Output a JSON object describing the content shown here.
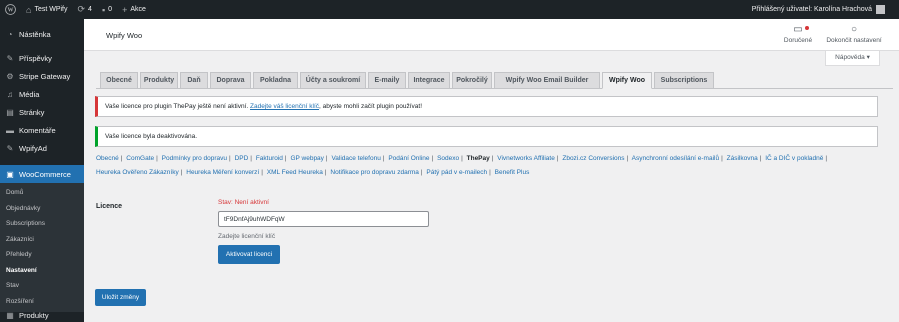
{
  "adminbar": {
    "site_name": "Test WPify",
    "updates_count": "4",
    "comments_count": "0",
    "new_label": "Akce",
    "user_greeting": "Přihlášený uživatel: Karolína Hrachová"
  },
  "sidebar": {
    "items": [
      {
        "label": "Nástěnka",
        "icon": "dashboard-icon"
      },
      {
        "label": "Příspěvky",
        "icon": "pin-icon"
      },
      {
        "label": "Stripe Gateway",
        "icon": "gear-icon"
      },
      {
        "label": "Média",
        "icon": "media-icon"
      },
      {
        "label": "Stránky",
        "icon": "page-icon"
      },
      {
        "label": "Komentáře",
        "icon": "comment-icon"
      },
      {
        "label": "WpifyAd",
        "icon": "pin-icon"
      }
    ],
    "woocommerce": {
      "label": "WooCommerce",
      "submenu": [
        "Domů",
        "Objednávky",
        "Subscriptions",
        "Zákazníci",
        "Přehledy",
        "Nastavení",
        "Stav",
        "Rozšíření"
      ],
      "current": "Nastavení"
    },
    "bottom_item": {
      "label": "Produkty",
      "icon": "box-icon"
    }
  },
  "header": {
    "title": "Wpify Woo",
    "inbox_label": "Doručené",
    "finish_setup_label": "Dokončit nastavení",
    "help_label": "Nápověda"
  },
  "tabs": [
    "Obecné",
    "Produkty",
    "Daň",
    "Doprava",
    "Pokladna",
    "Účty a soukromí",
    "E-maily",
    "Integrace",
    "Pokročilý",
    "Wpify Woo Email Builder",
    "Wpify Woo",
    "Subscriptions"
  ],
  "active_tab": "Wpify Woo",
  "notices": {
    "error_before": "Vaše licence pro plugin ThePay ještě není aktivní. ",
    "error_link": "Zadejte váš licenční klíč",
    "error_after": ", abyste mohli začít plugin používat!",
    "success": "Vaše licence byla deaktivována."
  },
  "subsections": [
    "Obecné",
    "ComGate",
    "Podmínky pro dopravu",
    "DPD",
    "Fakturoid",
    "GP webpay",
    "Validace telefonu",
    "Podání Online",
    "Sodexo",
    "ThePay",
    "Vivnetworks Affiliate",
    "Zbozi.cz Conversions",
    "Asynchronní odesílání e-mailů",
    "Zásilkovna",
    "IČ a DIČ v pokladně",
    "Heureka Ověřeno Zákazníky",
    "Heureka Měření konverzí",
    "XML Feed Heureka",
    "Notifikace pro dopravu zdarma",
    "Pátý pád v e-mailech",
    "Benefit Plus"
  ],
  "current_subsection": "ThePay",
  "form": {
    "label": "Licence",
    "status": "Stav: Není aktivní",
    "license_value": "tF9DnfAj9uhWDFqW",
    "description": "Zadejte licenční klíč",
    "activate_label": "Aktivovat licenci",
    "save_label": "Uložit změny"
  },
  "colors": {
    "admin_dark": "#1d2327",
    "primary": "#2271b1",
    "error": "#d63638",
    "success": "#00a32a"
  }
}
